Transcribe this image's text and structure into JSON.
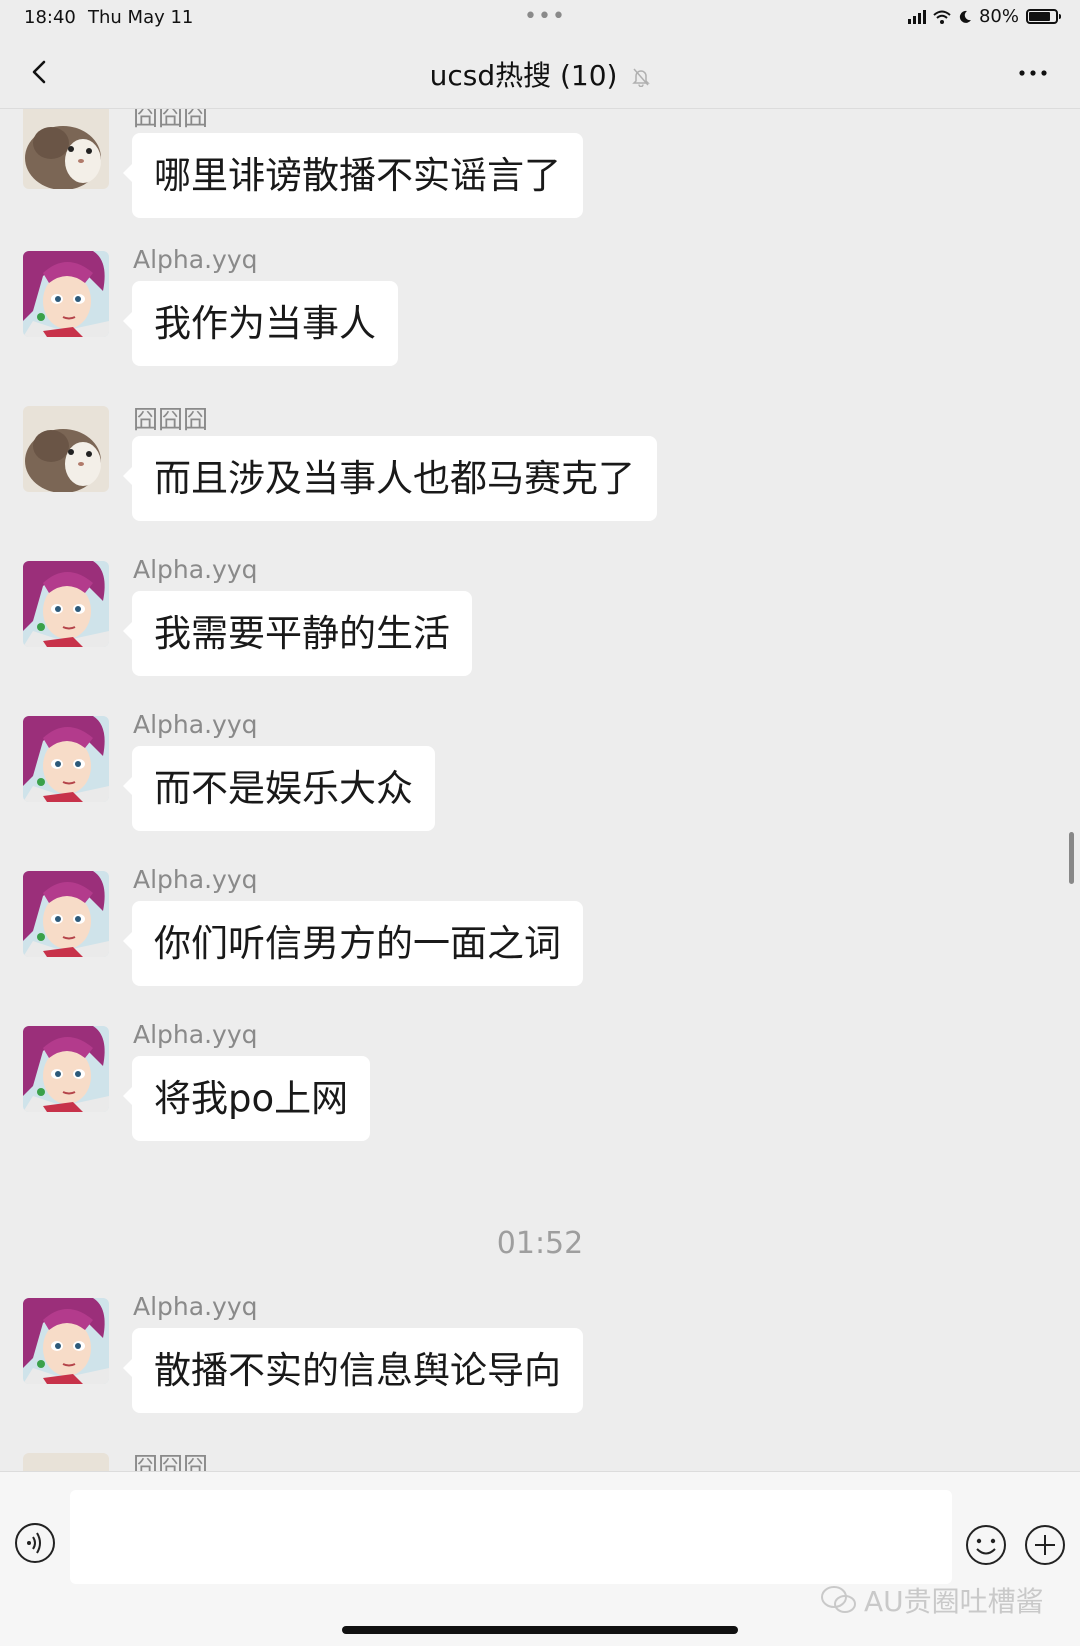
{
  "status_bar": {
    "time": "18:40",
    "date": "Thu May 11",
    "battery": "80%"
  },
  "nav": {
    "title": "ucsd热搜 (10)"
  },
  "messages": [
    {
      "sender": "囧囧囧",
      "avatar": "cat-avatar",
      "text": "哪里诽谤散播不实谣言了"
    },
    {
      "sender": "Alpha.yyq",
      "avatar": "anime-girl-avatar",
      "text": "我作为当事人"
    },
    {
      "sender": "囧囧囧",
      "avatar": "cat-avatar",
      "text": "而且涉及当事人也都马赛克了"
    },
    {
      "sender": "Alpha.yyq",
      "avatar": "anime-girl-avatar",
      "text": "我需要平静的生活"
    },
    {
      "sender": "Alpha.yyq",
      "avatar": "anime-girl-avatar",
      "text": "而不是娱乐大众"
    },
    {
      "sender": "Alpha.yyq",
      "avatar": "anime-girl-avatar",
      "text": "你们听信男方的一面之词"
    },
    {
      "sender": "Alpha.yyq",
      "avatar": "anime-girl-avatar",
      "text": "将我po上网"
    }
  ],
  "timestamp": "01:52",
  "messages_after": [
    {
      "sender": "Alpha.yyq",
      "avatar": "anime-girl-avatar",
      "text": "散播不实的信息舆论导向"
    },
    {
      "sender": "囧囧囧",
      "avatar": "cat-avatar",
      "text": ""
    }
  ],
  "input": {
    "value": "",
    "placeholder": ""
  },
  "watermark": "AU贵圈吐槽酱",
  "colors": {
    "background": "#ededed",
    "bubble": "#ffffff",
    "nickname": "#8a8a8a",
    "timestamp": "#9e9e9e"
  }
}
